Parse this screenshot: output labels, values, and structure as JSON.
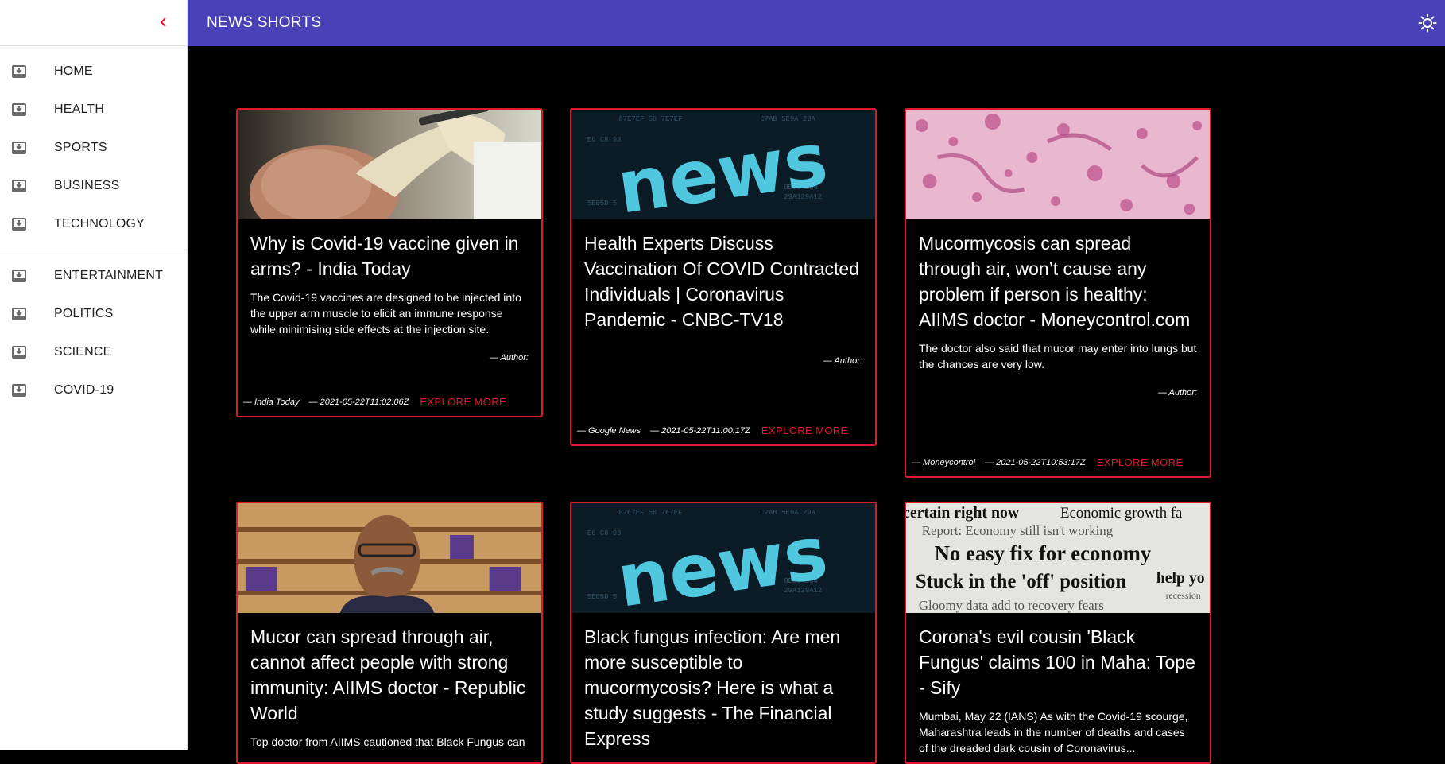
{
  "app": {
    "title": "NEWS SHORTS"
  },
  "icons": {
    "collapse": "chevron-left-icon",
    "nav": "inbox-download-icon",
    "theme": "sun-icon"
  },
  "colors": {
    "accent": "#e0192b",
    "topbar": "#4841b7"
  },
  "sidebar": {
    "items": [
      {
        "label": "HOME"
      },
      {
        "label": "HEALTH"
      },
      {
        "label": "SPORTS"
      },
      {
        "label": "BUSINESS"
      },
      {
        "label": "TECHNOLOGY"
      },
      {
        "label": "ENTERTAINMENT"
      },
      {
        "label": "POLITICS"
      },
      {
        "label": "SCIENCE"
      },
      {
        "label": "COVID-19"
      }
    ]
  },
  "articles": [
    {
      "title": "Why is Covid-19 vaccine given in arms? - India Today",
      "description": "The Covid-19 vaccines are designed to be injected into the upper arm muscle to elicit an immune response while minimising side effects at the injection site.",
      "author": "— Author:",
      "source": "— India Today",
      "published": "— 2021-05-22T11:02:06Z",
      "cta": "EXPLORE MORE"
    },
    {
      "title": "Health Experts Discuss Vaccination Of COVID Contracted Individuals | Coronavirus Pandemic - CNBC-TV18",
      "description": "",
      "author": "— Author:",
      "source": "— Google News",
      "published": "— 2021-05-22T11:00:17Z",
      "cta": "EXPLORE MORE"
    },
    {
      "title": "Mucormycosis can spread through air, won’t cause any problem if person is healthy: AIIMS doctor - Moneycontrol.com",
      "description": "The doctor also said that mucor may enter into lungs but the chances are very low.",
      "author": "— Author:",
      "source": "— Moneycontrol",
      "published": "— 2021-05-22T10:53:17Z",
      "cta": "EXPLORE MORE"
    },
    {
      "title": "Mucor can spread through air, cannot affect people with strong immunity: AIIMS doctor - Republic World",
      "description": "Top doctor from AIIMS cautioned that Black Fungus can"
    },
    {
      "title": "Black fungus infection: Are men more susceptible to mucormycosis? Here is what a study suggests - The Financial Express",
      "description": ""
    },
    {
      "title": "Corona's evil cousin 'Black Fungus' claims 100 in Maha: Tope - Sify",
      "description": "Mumbai, May 22 (IANS) As with the Covid-19 scourge, Maharashtra leads in the number of deaths and cases of the dreaded dark cousin of Coronavirus..."
    }
  ],
  "news_image_text": "news",
  "newspaper_image": {
    "lines": [
      "certain right now",
      "Economic growth fa",
      "Report: Economy still isn't working",
      "No easy fix for economy",
      "Stuck in the 'off' position",
      "help yo",
      "recession",
      "Gloomy data add to recovery fears"
    ]
  }
}
